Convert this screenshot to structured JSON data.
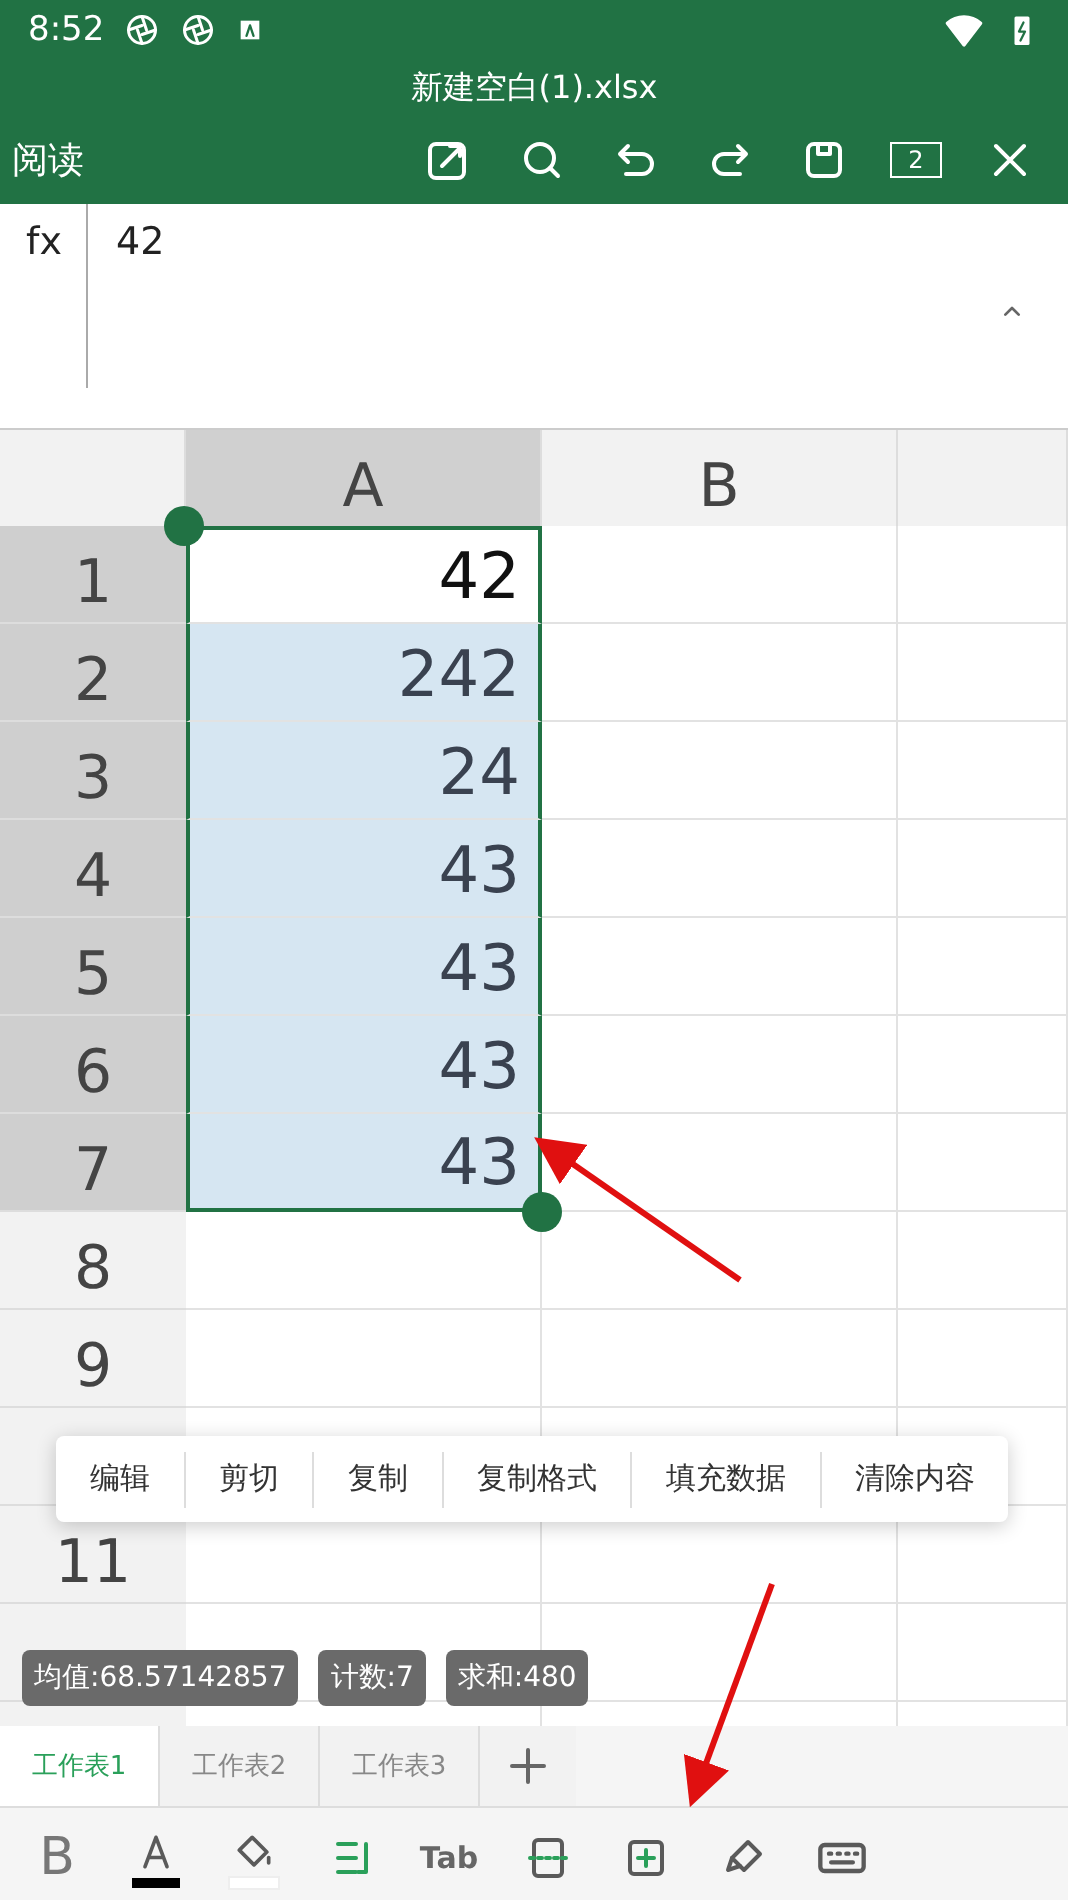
{
  "status_bar": {
    "time": "8:52"
  },
  "title": "新建空白(1).xlsx",
  "toolbar": {
    "mode": "阅读",
    "page_count": "2"
  },
  "formula_bar": {
    "label": "fx",
    "value": "42"
  },
  "columns": [
    {
      "selected": false
    },
    {
      "label": "A",
      "selected": true
    },
    {
      "label": "B",
      "selected": false
    }
  ],
  "rows": [
    {
      "label": "1",
      "selected": true,
      "cell": {
        "value": "42",
        "selected": true,
        "active": true
      }
    },
    {
      "label": "2",
      "selected": true,
      "cell": {
        "value": "242",
        "selected": true,
        "active": false
      }
    },
    {
      "label": "3",
      "selected": true,
      "cell": {
        "value": "24",
        "selected": true,
        "active": false
      }
    },
    {
      "label": "4",
      "selected": true,
      "cell": {
        "value": "43",
        "selected": true,
        "active": false
      }
    },
    {
      "label": "5",
      "selected": true,
      "cell": {
        "value": "43",
        "selected": true,
        "active": false
      }
    },
    {
      "label": "6",
      "selected": true,
      "cell": {
        "value": "43",
        "selected": true,
        "active": false
      }
    },
    {
      "label": "7",
      "selected": true,
      "cell": {
        "value": "43",
        "selected": true,
        "active": false
      }
    },
    {
      "label": "8",
      "selected": false
    },
    {
      "label": "9",
      "selected": false
    },
    {
      "selected": false
    },
    {
      "label": "11",
      "selected": false
    },
    {
      "selected": false
    },
    {
      "selected": false
    }
  ],
  "context_menu": [
    "编辑",
    "剪切",
    "复制",
    "复制格式",
    "填充数据",
    "清除内容"
  ],
  "stats": [
    "均值:68.57142857",
    "计数:7",
    "求和:480"
  ],
  "sheet_tabs": [
    {
      "label": "工作表1",
      "selected": true
    },
    {
      "label": "工作表2",
      "selected": false
    },
    {
      "label": "工作表3",
      "selected": false
    }
  ],
  "format_toolbar": [
    {
      "kind": "bold",
      "label": "B"
    },
    {
      "kind": "font-color",
      "color": "#000000"
    },
    {
      "kind": "fill-color",
      "color": "#ffffff"
    },
    {
      "kind": "wrap"
    },
    {
      "kind": "tab",
      "label": "Tab"
    },
    {
      "kind": "border"
    },
    {
      "kind": "insert"
    },
    {
      "kind": "brush"
    },
    {
      "kind": "keyboard"
    }
  ]
}
